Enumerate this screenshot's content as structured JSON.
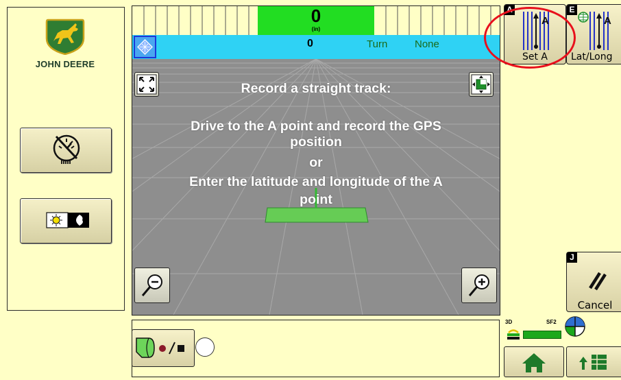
{
  "brand": {
    "wordmark": "JOHN DEERE"
  },
  "guidance": {
    "deviation_value": "0",
    "deviation_unit": "(in)",
    "offset_value": "0",
    "turn_label": "Turn",
    "turn_value": "None"
  },
  "map": {
    "instruction_title": "Record a straight track:",
    "instruction_line1": "Drive to the A point and record the GPS",
    "instruction_line2": "position",
    "instruction_or": "or",
    "instruction_line3": "Enter the latitude and longitude of the A",
    "instruction_line4": "point"
  },
  "buttons": {
    "set_a": {
      "label": "Set A",
      "tag": "A"
    },
    "lat_long": {
      "label": "Lat/Long",
      "tag": "E"
    },
    "cancel": {
      "label": "Cancel",
      "tag": "J"
    }
  },
  "gps": {
    "fix_label": "3D",
    "signal_label": "SF2"
  },
  "icons": {
    "logo": "john-deere-logo-icon",
    "speedo": "speedometer-off-icon",
    "daynight": "day-night-icon",
    "fullscreen": "fullscreen-icon",
    "pan": "pan-icon",
    "zoom_out": "zoom-out-icon",
    "zoom_in": "zoom-in-icon",
    "home": "home-icon",
    "menu": "menu-icon"
  },
  "colors": {
    "background": "#ffffc6",
    "light_bar_center": "#22dd22",
    "info_bar": "#2fd2f4",
    "vehicle_green": "#66cc55",
    "annotation": "#e8101c"
  }
}
